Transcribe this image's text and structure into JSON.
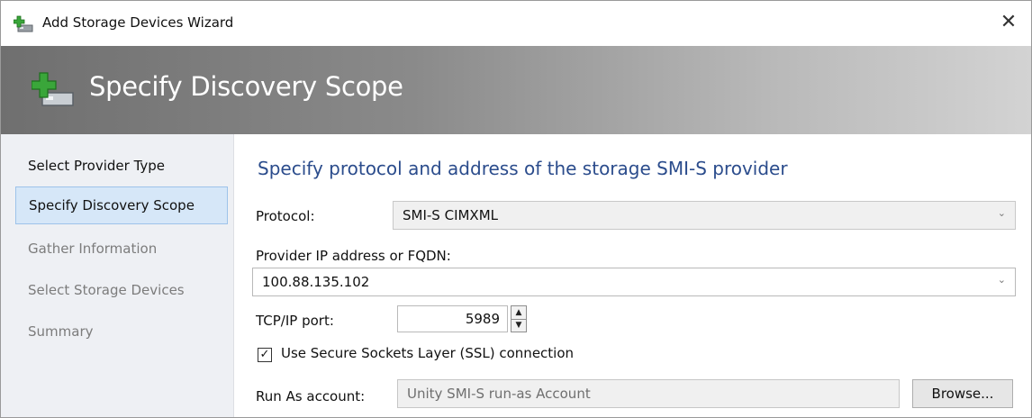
{
  "window": {
    "title": "Add Storage Devices Wizard",
    "close_glyph": "✕"
  },
  "banner": {
    "title": "Specify Discovery Scope",
    "icon": "add-storage-icon"
  },
  "sidebar": {
    "items": [
      {
        "label": "Select Provider Type",
        "state": "normal"
      },
      {
        "label": "Specify Discovery Scope",
        "state": "active"
      },
      {
        "label": "Gather Information",
        "state": "dim"
      },
      {
        "label": "Select Storage Devices",
        "state": "dim"
      },
      {
        "label": "Summary",
        "state": "dim"
      }
    ]
  },
  "main": {
    "heading": "Specify protocol and address of the storage SMI-S provider",
    "protocol_label": "Protocol:",
    "protocol_value": "SMI-S CIMXML",
    "address_label": "Provider IP address or FQDN:",
    "address_value": "100.88.135.102",
    "port_label": "TCP/IP port:",
    "port_value": "5989",
    "ssl_label": "Use Secure Sockets Layer (SSL) connection",
    "ssl_checked": true,
    "runas_label": "Run As account:",
    "runas_value": "Unity SMI-S run-as Account",
    "browse_label": "Browse..."
  },
  "colors": {
    "heading": "#2b4c8c",
    "active_item_bg": "#d6e7f8",
    "icon_green": "#3aa63a"
  }
}
